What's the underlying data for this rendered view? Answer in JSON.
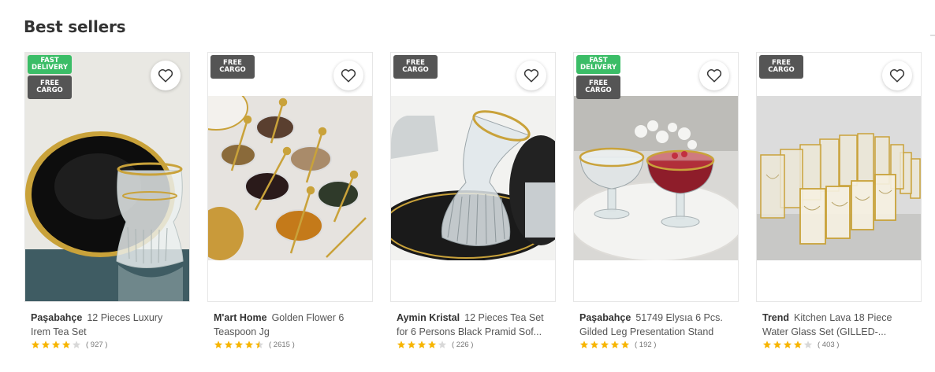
{
  "section": {
    "title": "Best sellers"
  },
  "products": [
    {
      "brand": "Paşabahçe",
      "name": "12 Pieces Luxury Irem Tea Set",
      "rating": 4,
      "rating_count": "( 927 )",
      "badges": [
        "FAST DELIVERY",
        "FREE CARGO"
      ],
      "image": "black-saucer-gold-rim-tea-glass"
    },
    {
      "brand": "M'art Home",
      "name": "Golden Flower 6 Teaspoon Jg",
      "rating": 4.5,
      "rating_count": "( 2615 )",
      "badges": [
        "FREE CARGO"
      ],
      "image": "gold-spoons-in-snack-bowls"
    },
    {
      "brand": "Aymin Kristal",
      "name": "12 Pieces Tea Set for 6 Persons Black Pramid Sof...",
      "rating": 4,
      "rating_count": "( 226 )",
      "badges": [
        "FREE CARGO"
      ],
      "image": "ribbed-tea-glass-black-saucer"
    },
    {
      "brand": "Paşabahçe",
      "name": "51749 Elysıa 6 Pcs. Gilded Leg Presentation Stand",
      "rating": 5,
      "rating_count": "( 192 )",
      "badges": [
        "FAST DELIVERY",
        "FREE CARGO"
      ],
      "image": "crystal-dessert-bowls-on-marble"
    },
    {
      "brand": "Trend",
      "name": "Kitchen Lava 18 Piece Water Glass Set (GILLED-...",
      "rating": 4,
      "rating_count": "( 403 )",
      "badges": [
        "FREE CARGO"
      ],
      "image": "gold-rim-water-glasses"
    }
  ],
  "colors": {
    "fast_delivery": "#3bbd67",
    "free_cargo": "#555555",
    "star_filled": "#f7b500",
    "star_empty": "#d8d8d8"
  },
  "icons": {
    "favorite": "heart-outline-icon",
    "rating": "star-icon"
  }
}
